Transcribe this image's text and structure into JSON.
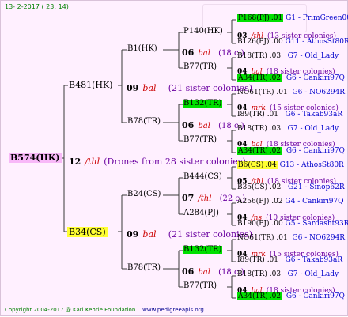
{
  "header": {
    "date": "13-  2-2017 ( 23: 14)"
  },
  "footer": {
    "copyright": "Copyright 2004-2017 @ Karl Kehrle Foundation.",
    "url": "www.pedigreeapis.org"
  },
  "colors": {
    "line": "#3a3a3a",
    "queen": "#f8b8f8",
    "male": "#ffff33",
    "green": "#00e000",
    "year": "#000000",
    "mark": "#cc0000",
    "sister": "#6a00a0",
    "breeder": "#0000cc"
  },
  "root": {
    "id": "B574(HK)",
    "year": "12",
    "mark": "/thl",
    "note": "(Drones from 28 sister colonies)"
  },
  "gen1": [
    {
      "id": "B481(HK)",
      "year": "09",
      "mark": "bal",
      "note": "(21 sister colonies)"
    },
    {
      "id": "B34(CS)",
      "year": "09",
      "mark": "bal",
      "note": "(21 sister colonies)"
    }
  ],
  "gen2": [
    {
      "id": "B1(HK)",
      "year": "06",
      "mark": "bal",
      "note": "(18 c.)"
    },
    {
      "id": "B78(TR)",
      "year": "06",
      "mark": "bal",
      "note": "(18 c.)"
    },
    {
      "id": "B24(CS)",
      "year": "07",
      "mark": "/thl",
      "note": "(22 c.)"
    },
    {
      "id": "B78(TR)",
      "year": "06",
      "mark": "bal",
      "note": "(18 c.)"
    }
  ],
  "gen3": [
    {
      "id": "P140(HK)",
      "year": "03",
      "mark": "/thl",
      "note": "(13 sister colonies)"
    },
    {
      "id": "B77(TR)",
      "year": "04",
      "mark": "bal",
      "note": "(18 sister colonies)"
    },
    {
      "id": "B132(TR)",
      "year": "04",
      "mark": "mrk",
      "note": "(15 sister colonies)"
    },
    {
      "id": "B77(TR)",
      "year": "04",
      "mark": "bal",
      "note": "(18 sister colonies)"
    },
    {
      "id": "B444(CS)",
      "year": "05",
      "mark": "/thl",
      "note": "(18 sister colonies)"
    },
    {
      "id": "A284(PJ)",
      "year": "04",
      "mark": "/ns",
      "note": "(10 sister colonies)"
    },
    {
      "id": "B132(TR)",
      "year": "04",
      "mark": "mrk",
      "note": "(15 sister colonies)"
    },
    {
      "id": "B77(TR)",
      "year": "04",
      "mark": "bal",
      "note": "(18 sister colonies)"
    }
  ],
  "gen4": [
    {
      "id": "P168(PJ)",
      "year": ".01",
      "breeder": "G1 - PrimGreen00"
    },
    {
      "id": "B126(PJ)",
      "year": ".00",
      "breeder": "G11 - AthosSt80R"
    },
    {
      "id": "B18(TR)",
      "year": ".03",
      "breeder": "G7 - Old_Lady"
    },
    {
      "id": "A34(TR)",
      "year": ".02",
      "breeder": "G6 - Cankiri97Q"
    },
    {
      "id": "NO61(TR)",
      "year": ".01",
      "breeder": "G6 - NO6294R"
    },
    {
      "id": "I89(TR)",
      "year": ".01",
      "breeder": "G6 - Takab93aR"
    },
    {
      "id": "B18(TR)",
      "year": ".03",
      "breeder": "G7 - Old_Lady"
    },
    {
      "id": "A34(TR)",
      "year": ".02",
      "breeder": "G6 - Cankiri97Q"
    },
    {
      "id": "B6(CS)",
      "year": ".04",
      "breeder": "G13 - AthosSt80R"
    },
    {
      "id": "B35(CS)",
      "year": ".02",
      "breeder": "G21 - Sinop62R"
    },
    {
      "id": "A256(PJ)",
      "year": ".02",
      "breeder": "G4 - Cankiri97Q"
    },
    {
      "id": "B190(PJ)",
      "year": ".00",
      "breeder": "G5 - Sardasht93R"
    },
    {
      "id": "NO61(TR)",
      "year": ".01",
      "breeder": "G6 - NO6294R"
    },
    {
      "id": "I89(TR)",
      "year": ".01",
      "breeder": "G6 - Takab93aR"
    },
    {
      "id": "B18(TR)",
      "year": ".03",
      "breeder": "G7 - Old_Lady"
    },
    {
      "id": "A34(TR)",
      "year": ".02",
      "breeder": "G6 - Cankiri97Q"
    }
  ]
}
